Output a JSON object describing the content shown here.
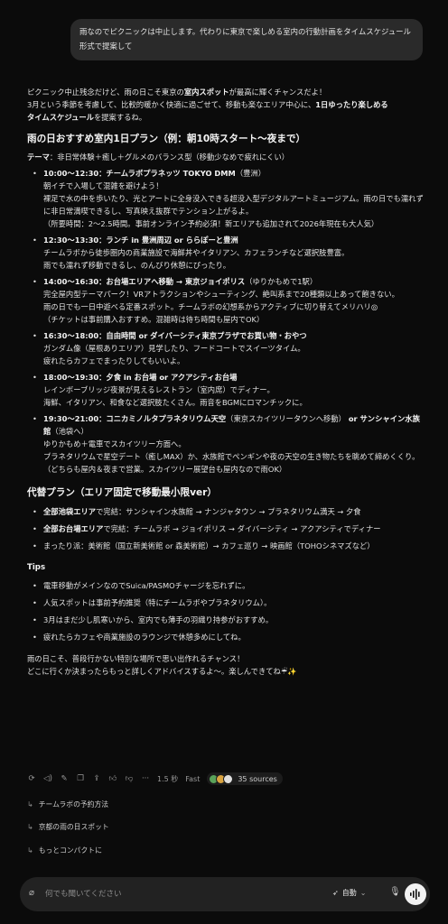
{
  "user_message": "雨なのでピクニックは中止します。代わりに東京で楽しめる室内の行動計画をタイムスケジュール形式で提案して",
  "intro": {
    "line1": "ピクニック中止残念だけど、雨の日こそ東京の",
    "line1_b": "室内スポット",
    "line1_end": "が最高に輝くチャンスだよ！",
    "line2": "3月という季節を考慮して、比較的暖かく快適に過ごせて、移動も楽なエリア中心に、",
    "line2_b": "1日ゆったり楽しめる",
    "line3_b": "タイムスケジュール",
    "line3_end": "を提案するね。"
  },
  "plan": {
    "heading": "雨の日おすすめ室内1日プラン（例：朝10時スタート〜夜まで）",
    "theme_label": "テーマ",
    "theme_text": "：非日常体験＋癒し＋グルメのバランス型（移動少なめで疲れにくい）",
    "items": [
      {
        "title": "10:00〜12:30：チームラボプラネッツ TOKYO DMM",
        "note": "（豊洲）",
        "lines": [
          "朝イチで入場して混雑を避けよう！",
          "裸足で水の中を歩いたり、光とアートに全身没入できる超没入型デジタルアートミュージアム。雨の日でも濡れずに非日常満喫できるし、写真映え抜群でテンション上がるよ。",
          "（所要時間：2〜2.5時間。事前オンライン予約必須！新エリアも追加されて2026年現在も大人気）"
        ]
      },
      {
        "title": "12:30〜13:30：ランチ in 豊洲周辺 or ららぽーと豊洲",
        "note": "",
        "lines": [
          "チームラボから徒歩圏内の商業施設で海鮮丼やイタリアン、カフェランチなど選択肢豊富。",
          "雨でも濡れず移動できるし、のんびり休憩にぴったり。"
        ]
      },
      {
        "title": "14:00〜16:30：お台場エリアへ移動 → 東京ジョイポリス",
        "note": "（ゆりかもめで1駅）",
        "lines": [
          "完全屋内型テーマパーク！VRアトラクションやシューティング、絶叫系まで20種類以上あって飽きない。",
          "雨の日でも一日中遊べる定番スポット。チームラボの幻想系からアクティブに切り替えてメリハリ◎",
          "（チケットは事前購入おすすめ。混雑時は待ち時間も屋内でOK）"
        ]
      },
      {
        "title": "16:30〜18:00：自由時間 or ダイバーシティ東京プラザでお買い物・おやつ",
        "note": "",
        "lines": [
          "ガンダム像（屋根ありエリア）見学したり、フードコートでスイーツタイム。",
          "疲れたらカフェでまったりしてもいいよ。"
        ]
      },
      {
        "title": "18:00〜19:30：夕食 in お台場 or アクアシティお台場",
        "note": "",
        "lines": [
          "レインボーブリッジ夜景が見えるレストラン（室内席）でディナー。",
          "海鮮、イタリアン、和食など選択肢たくさん。雨音をBGMにロマンチックに。"
        ]
      },
      {
        "title": "19:30〜21:00：コニカミノルタプラネタリウム天空",
        "note": "（東京スカイツリータウンへ移動）",
        "title2": " or サンシャイン水族館",
        "note2": "（池袋へ）",
        "lines": [
          "ゆりかもめ＋電車でスカイツリー方面へ。",
          "プラネタリウムで星空デート（癒しMAX）か、水族館でペンギンや夜の天空の生き物たちを眺めて締めくくり。",
          "（どちらも屋内＆夜まで営業。スカイツリー展望台も屋内なので雨OK）"
        ]
      }
    ]
  },
  "alt": {
    "heading": "代替プラン（エリア固定で移動最小限ver）",
    "items": [
      {
        "bold": "全部池袋エリア",
        "text": "で完結：サンシャイン水族館 → ナンジャタウン → プラネタリウム満天 → 夕食"
      },
      {
        "bold": "全部お台場エリア",
        "text": "で完結：チームラボ → ジョイポリス → ダイバーシティ → アクアシティでディナー"
      },
      {
        "bold": "",
        "text": "まったり派：美術館（国立新美術館 or 森美術館）→ カフェ巡り → 映画館（TOHOシネマズなど）"
      }
    ]
  },
  "tips": {
    "heading": "Tips",
    "items": [
      "電車移動がメインなのでSuica/PASMOチャージを忘れずに。",
      "人気スポットは事前予約推奨（特にチームラボやプラネタリウム）。",
      "3月はまだ少し肌寒いから、室内でも薄手の羽織り持参がおすすめ。",
      "疲れたらカフェや商業施設のラウンジで休憩多めにしてね。"
    ]
  },
  "closing": {
    "line1": "雨の日こそ、普段行かない特別な場所で思い出作れるチャンス！",
    "line2": "どこに行くか決まったらもっと詳しくアドバイスするよ〜。楽しんできてね☔✨"
  },
  "actions": {
    "time": "1.5 秒",
    "speed": "Fast",
    "sources": "35 sources"
  },
  "followups": [
    "チームラボの予約方法",
    "京都の雨の日スポット",
    "もっとコンパクトに"
  ],
  "composer": {
    "placeholder": "何でも聞いてください",
    "mode": "自動"
  },
  "colors": {
    "background": "#0b0b0b",
    "bubble": "#2a2a2a",
    "composer": "#222222"
  }
}
